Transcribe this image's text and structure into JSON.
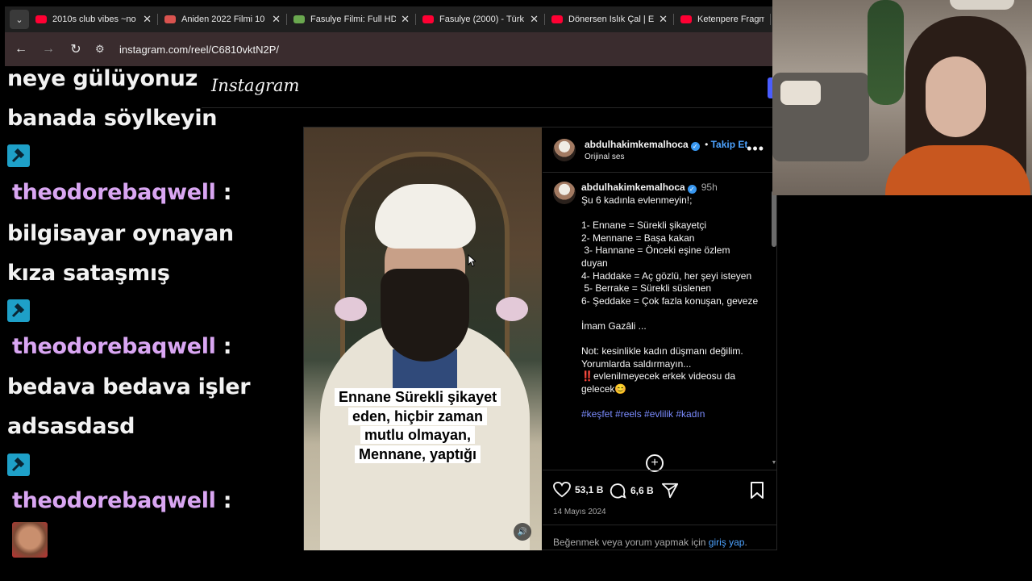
{
  "browser": {
    "tabs": [
      {
        "title": "2010s club vibes ~no",
        "favicon_color": "#ff0033"
      },
      {
        "title": "Aniden 2022 Filmi 10",
        "favicon_color": "#d9534f"
      },
      {
        "title": "Fasulye Filmi: Full HD",
        "favicon_color": "#6aa84f"
      },
      {
        "title": "Fasulye (2000) - Türk",
        "favicon_color": "#ff0033"
      },
      {
        "title": "Dönersen Islık Çal | E",
        "favicon_color": "#ff0033"
      },
      {
        "title": "Ketenpere Fragman",
        "favicon_color": "#ff0033"
      }
    ],
    "url": "instagram.com/reel/C6810vktN2P/"
  },
  "chat": {
    "line1": "neye gülüyonuz",
    "line2": "banada söylkeyin",
    "user1": "theodorebaqwell",
    "sep1": ":",
    "line3": "bilgisayar oynayan",
    "line4": "kıza sataşmış",
    "user2": "theodorebaqwell",
    "sep2": ":",
    "line5": "bedava bedava işler",
    "line6": "adsasdasd",
    "user3": "theodorebaqwell",
    "sep3": ":"
  },
  "instagram": {
    "logo": "Instagram",
    "video_caption": "Ennane Sürekli şikayet eden, hiçbir zaman mutlu olmayan, Mennane, yaptığı",
    "author": "abdulhakimkemalhoca",
    "bullet": "•",
    "follow": "Takip Et",
    "audio": "Orijinal ses",
    "post_time": "95h",
    "caption_body": "Şu 6 kadınla evlenmeyin!;\n\n1- Ennane = Sürekli şikayetçi\n2- Mennane = Başa kakan\n 3- Hannane = Önceki eşine özlem duyan\n4- Haddake = Aç gözlü, her şeyi isteyen\n 5- Berrake = Sürekli süslenen\n6- Şeddake = Çok fazla konuşan, geveze\n\nİmam Gazâli ...\n\nNot: kesinlikle kadın düşmanı değilim. Yorumlarda saldırmayın...\n‼️evlenilmeyecek erkek videosu da gelecek😊",
    "hashtags": "#keşfet #reels #evlilik #kadın",
    "likes": "53,1 B",
    "comments_count": "6,6 B",
    "date": "14 Mayıs 2024",
    "login_text": "Beğenmek veya yorum yapmak için",
    "login_link": "giriş yap",
    "login_end": "."
  },
  "icons": {
    "badge": "hammer-icon",
    "like": "heart-icon",
    "comment": "comment-icon",
    "share": "share-icon",
    "save": "bookmark-icon",
    "add_comment": "plus-circle-icon"
  },
  "colors": {
    "accent": "#4da3ff",
    "username": "#d9a6f2",
    "address_bar": "#3a2c2e",
    "badge": "#1ea0c8"
  }
}
